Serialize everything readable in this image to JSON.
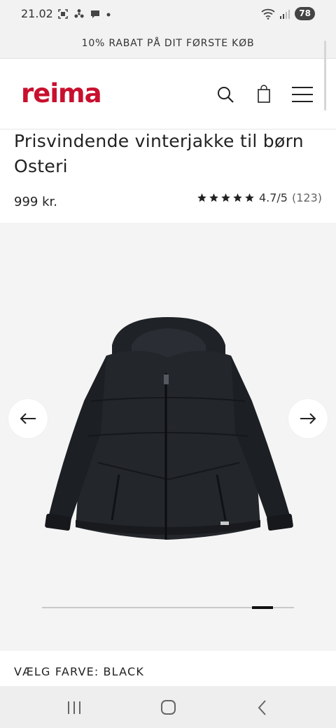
{
  "status_bar": {
    "time": "21.02",
    "battery": "78",
    "icons": [
      "screenshot-icon",
      "fan-icon",
      "chat-bubble-icon",
      "dot-icon",
      "wifi-icon",
      "signal-icon",
      "battery-icon"
    ]
  },
  "promo": {
    "text": "10% RABAT PÅ DIT FØRSTE KØB"
  },
  "header": {
    "logo_text": "reima",
    "brand_color": "#c8102e",
    "icons": [
      "search-icon",
      "shopping-bag-icon",
      "menu-icon"
    ]
  },
  "product": {
    "title": "Prisvindende vinterjakke til børn Osteri",
    "price": "999 kr.",
    "rating": {
      "stars": 5,
      "score_text": "4.7/5",
      "count_text": "(123)"
    }
  },
  "gallery": {
    "icons": [
      "arrow-left-icon",
      "arrow-right-icon"
    ],
    "progress": {
      "start_fraction": 0.833,
      "end_fraction": 0.917
    }
  },
  "color_select": {
    "label": "VÆLG FARVE:",
    "value": "BLACK"
  },
  "nav_bar": {
    "icons": [
      "recent-apps-icon",
      "home-icon",
      "back-icon"
    ]
  }
}
